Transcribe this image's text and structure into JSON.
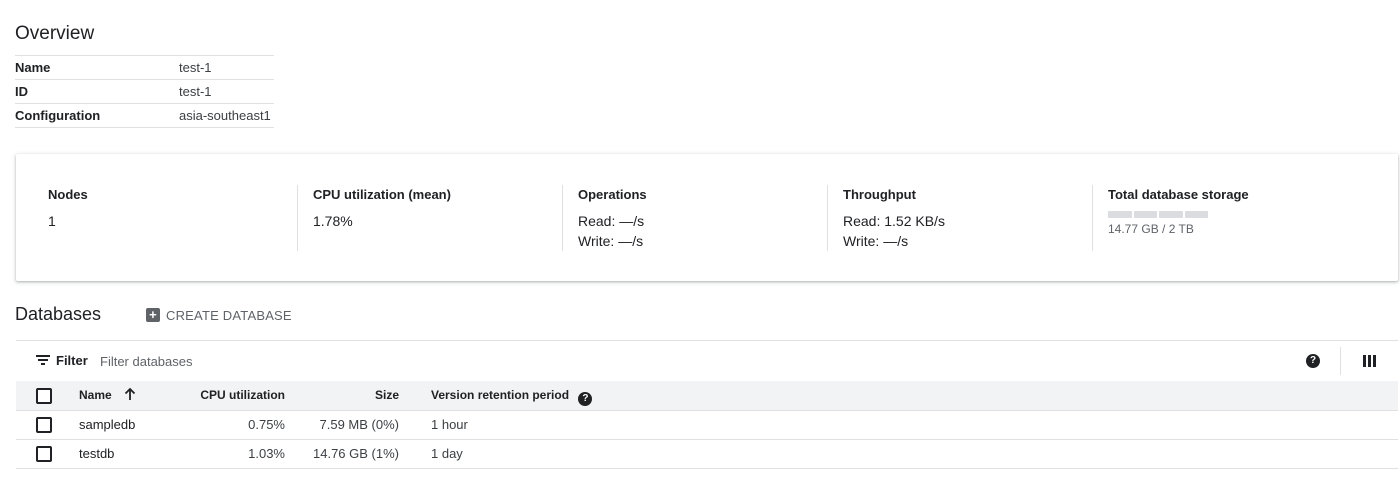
{
  "overview": {
    "title": "Overview",
    "rows": [
      {
        "key": "Name",
        "value": "test-1"
      },
      {
        "key": "ID",
        "value": "test-1"
      },
      {
        "key": "Configuration",
        "value": "asia-southeast1"
      }
    ]
  },
  "metrics": {
    "nodes": {
      "label": "Nodes",
      "value": "1"
    },
    "cpu": {
      "label": "CPU utilization (mean)",
      "value": "1.78%"
    },
    "operations": {
      "label": "Operations",
      "read": "Read: —/s",
      "write": "Write: —/s"
    },
    "throughput": {
      "label": "Throughput",
      "read": "Read: 1.52 KB/s",
      "write": "Write: —/s"
    },
    "storage": {
      "label": "Total database storage",
      "value": "14.77 GB / 2 TB",
      "used_fraction": 0.0074
    }
  },
  "databases": {
    "title": "Databases",
    "create_label": "CREATE DATABASE",
    "filter_label": "Filter",
    "filter_placeholder": "Filter databases",
    "columns": {
      "name": "Name",
      "cpu": "CPU utilization",
      "size": "Size",
      "retention": "Version retention period"
    },
    "rows": [
      {
        "name": "sampledb",
        "cpu": "0.75%",
        "size": "7.59 MB (0%)",
        "retention": "1 hour"
      },
      {
        "name": "testdb",
        "cpu": "1.03%",
        "size": "14.76 GB (1%)",
        "retention": "1 day"
      }
    ]
  }
}
